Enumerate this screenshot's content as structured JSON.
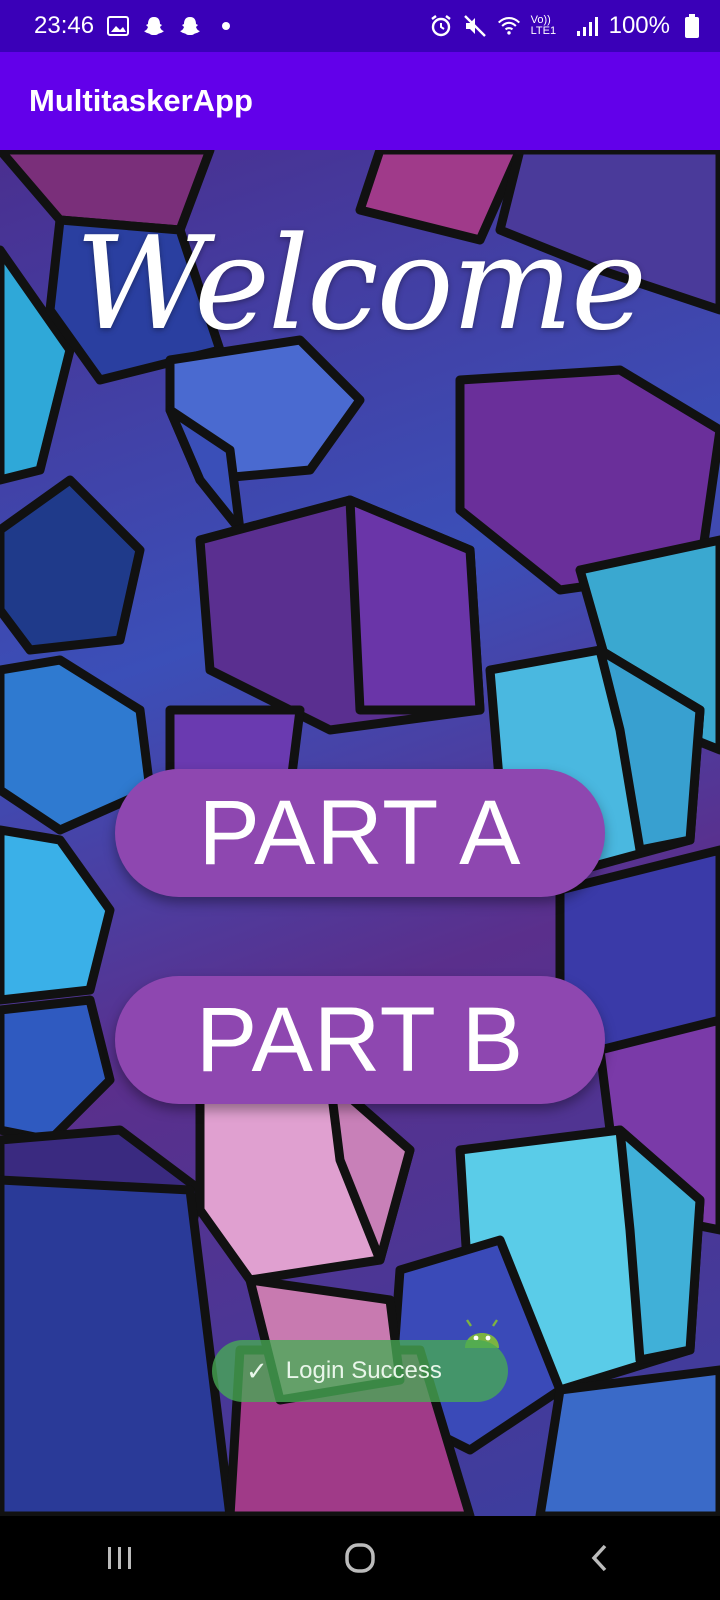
{
  "status_bar": {
    "time": "23:46",
    "left_icons": [
      "gallery-icon",
      "snapchat-icon",
      "snapchat-icon",
      "dot-icon"
    ],
    "right_icons": [
      "alarm-icon",
      "mute-icon",
      "wifi-icon",
      "volte-icon",
      "signal-icon"
    ],
    "volte_text": "Vo)) LTE1",
    "battery": "100%"
  },
  "app_bar": {
    "title": "MultitaskerApp"
  },
  "main": {
    "welcome_text": "Welcome",
    "buttons": [
      {
        "label": "PART A"
      },
      {
        "label": "PART B"
      }
    ]
  },
  "toast": {
    "icon": "check-icon",
    "text": "Login Success"
  },
  "nav_bar": {
    "items": [
      "recent-apps-icon",
      "home-icon",
      "back-icon"
    ]
  },
  "colors": {
    "status_bar": "#3a00b8",
    "app_bar": "#6200ea",
    "button": "#8e47b0",
    "toast": "#48aa54"
  }
}
